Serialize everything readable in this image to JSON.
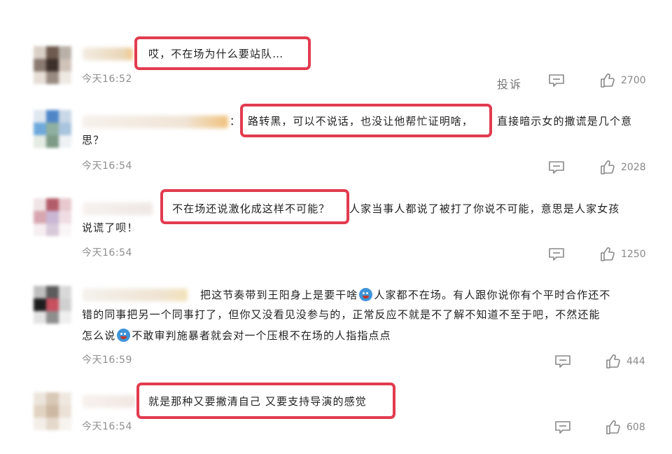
{
  "report_label": "投诉",
  "comments": [
    {
      "line1_a": "哎，不在场为什么要站队…",
      "time": "今天16:52",
      "likes": "2700"
    },
    {
      "line1_a": "：",
      "line1_hl": "路转黑，可以不说话，也没让他帮忙证明啥，",
      "line1_b": "直接暗示女的撒谎是几个意",
      "line2": "思？",
      "time": "今天16:54",
      "likes": "2028"
    },
    {
      "line1_hl": "不在场还说激化成这样不可能？",
      "line1_b": "人家当事人都说了被打了你说不可能，意思是人家女孩",
      "line2": "说谎了呗！",
      "time": "今天16:54",
      "likes": "1250"
    },
    {
      "line1_a": "把这节奏带到王阳身上是要干啥",
      "line1_b": "人家都不在场。有人跟你说你有个平时合作还不",
      "line2": "错的同事把另一个同事打了，但你又没看见没参与的，正常反应不就是不了解不知道不至于吧，不然还能",
      "line3_a": "怎么说",
      "line3_b": "不敢审判施暴者就会对一个压根不在场的人指指点点",
      "time": "今天16:59",
      "likes": "444"
    },
    {
      "line1_a": "就是那种又要撇清自己 又要支持导演的感觉",
      "time": "今天16:54",
      "likes": "608"
    }
  ],
  "colors": {
    "highlight": "#e23b4f",
    "time": "#8f8f8f",
    "action": "#888888"
  },
  "icons": [
    "comment-icon",
    "thumbs-up-icon",
    "emoji-icon"
  ]
}
